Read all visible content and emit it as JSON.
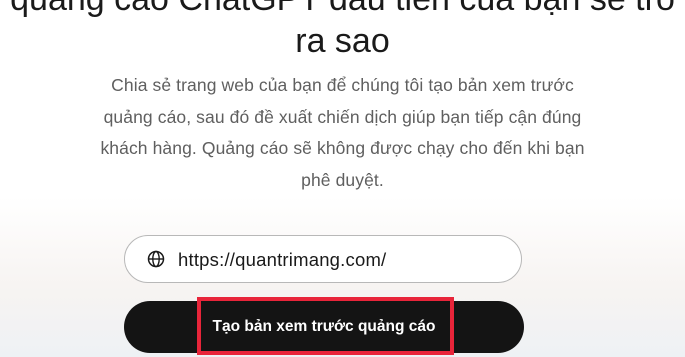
{
  "headline": {
    "line1": "quảng cáo ChatGPT đầu tiên của bạn sẽ trô",
    "line2": "ra sao"
  },
  "description": {
    "lines": [
      "Chia sẻ trang web của bạn để chúng tôi tạo bản xem trước",
      "quảng cáo, sau đó đề xuất chiến dịch giúp bạn tiếp cận đúng",
      "khách hàng. Quảng cáo sẽ không được chạy cho đến khi bạn",
      "phê duyệt."
    ]
  },
  "url_input": {
    "value": "https://quantrimang.com/",
    "icon": "globe-icon"
  },
  "cta": {
    "label": "Tạo bản xem trước quảng cáo"
  },
  "colors": {
    "button_bg": "#141414",
    "highlight_border": "#e8253a",
    "description_text": "#5f5f5f"
  }
}
